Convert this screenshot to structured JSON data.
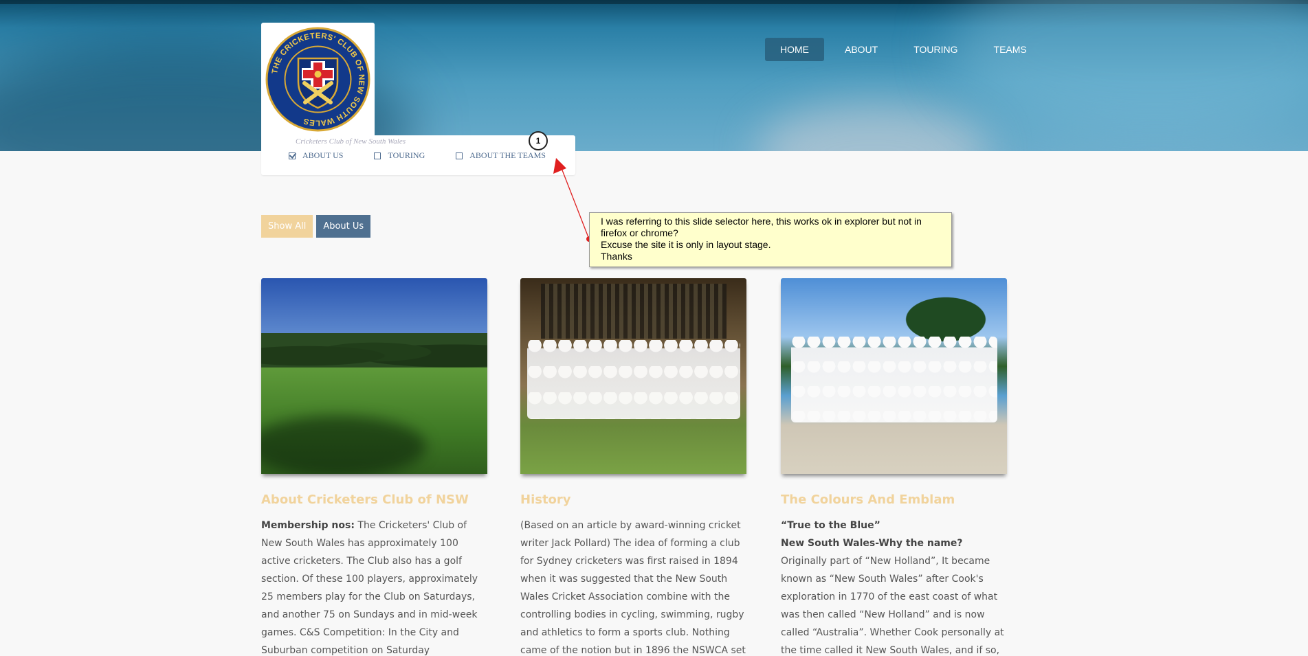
{
  "nav": {
    "items": [
      {
        "label": "HOME",
        "active": true
      },
      {
        "label": "ABOUT",
        "active": false
      },
      {
        "label": "TOURING",
        "active": false
      },
      {
        "label": "TEAMS",
        "active": false
      }
    ]
  },
  "logo": {
    "text": "THE CRICKETERS' CLUB OF NEW SOUTH WALES",
    "icon": "club-crest-icon"
  },
  "slide_selector": {
    "tagline": "Cricketers Club of New South Wales",
    "items": [
      {
        "label": "ABOUT US",
        "checked": true
      },
      {
        "label": "TOURING",
        "checked": false
      },
      {
        "label": "ABOUT THE TEAMS",
        "checked": false
      }
    ]
  },
  "annotation": {
    "badge": "1",
    "lines": [
      "I was referring to this slide selector here, this works ok in explorer but not in",
      "firefox or chrome?",
      "Excuse the site it is only in layout stage.",
      "Thanks"
    ],
    "color": "#ffffcc",
    "arrow_color": "#e02020"
  },
  "filters": {
    "show_all": "Show All",
    "about_us": "About Us"
  },
  "cards": [
    {
      "title": "About Cricketers Club of NSW",
      "lead": "Membership nos:",
      "text": " The Cricketers' Club of New South Wales has approximately 100 active cricketers. The Club also has a golf section. Of these 100 players, approximately 25 members play for the Club on Saturdays, and another 75 on Sundays and in mid-week games. C&S Competition: In the City and Suburban competition on Saturday afternoons, the Club"
    },
    {
      "title": "History",
      "text": "(Based on an article by award-winning cricket writer Jack Pollard) The idea of forming a club for Sydney cricketers was first raised in 1894 when it was suggested that the New South Wales Cricket Association combine with the controlling bodies in cycling, swimming, rugby and athletics to form a sports club. Nothing came of the notion but in 1896 the NSWCA set"
    },
    {
      "title": "The Colours And Emblam",
      "lead1": "“True to the Blue”",
      "lead2": "New South Wales-Why the name?",
      "text": "Originally part of “New Holland”, It became known as “New South Wales” after Cook's exploration in 1770 of the east coast of what was then called “New Holland” and is now called “Australia”. Whether Cook personally at the time called it New South Wales, and if so, why, is still"
    }
  ],
  "colors": {
    "accent_gold": "#f1d39c",
    "filter_blue": "#4f7090",
    "nav_active": "#2e6a8a"
  }
}
